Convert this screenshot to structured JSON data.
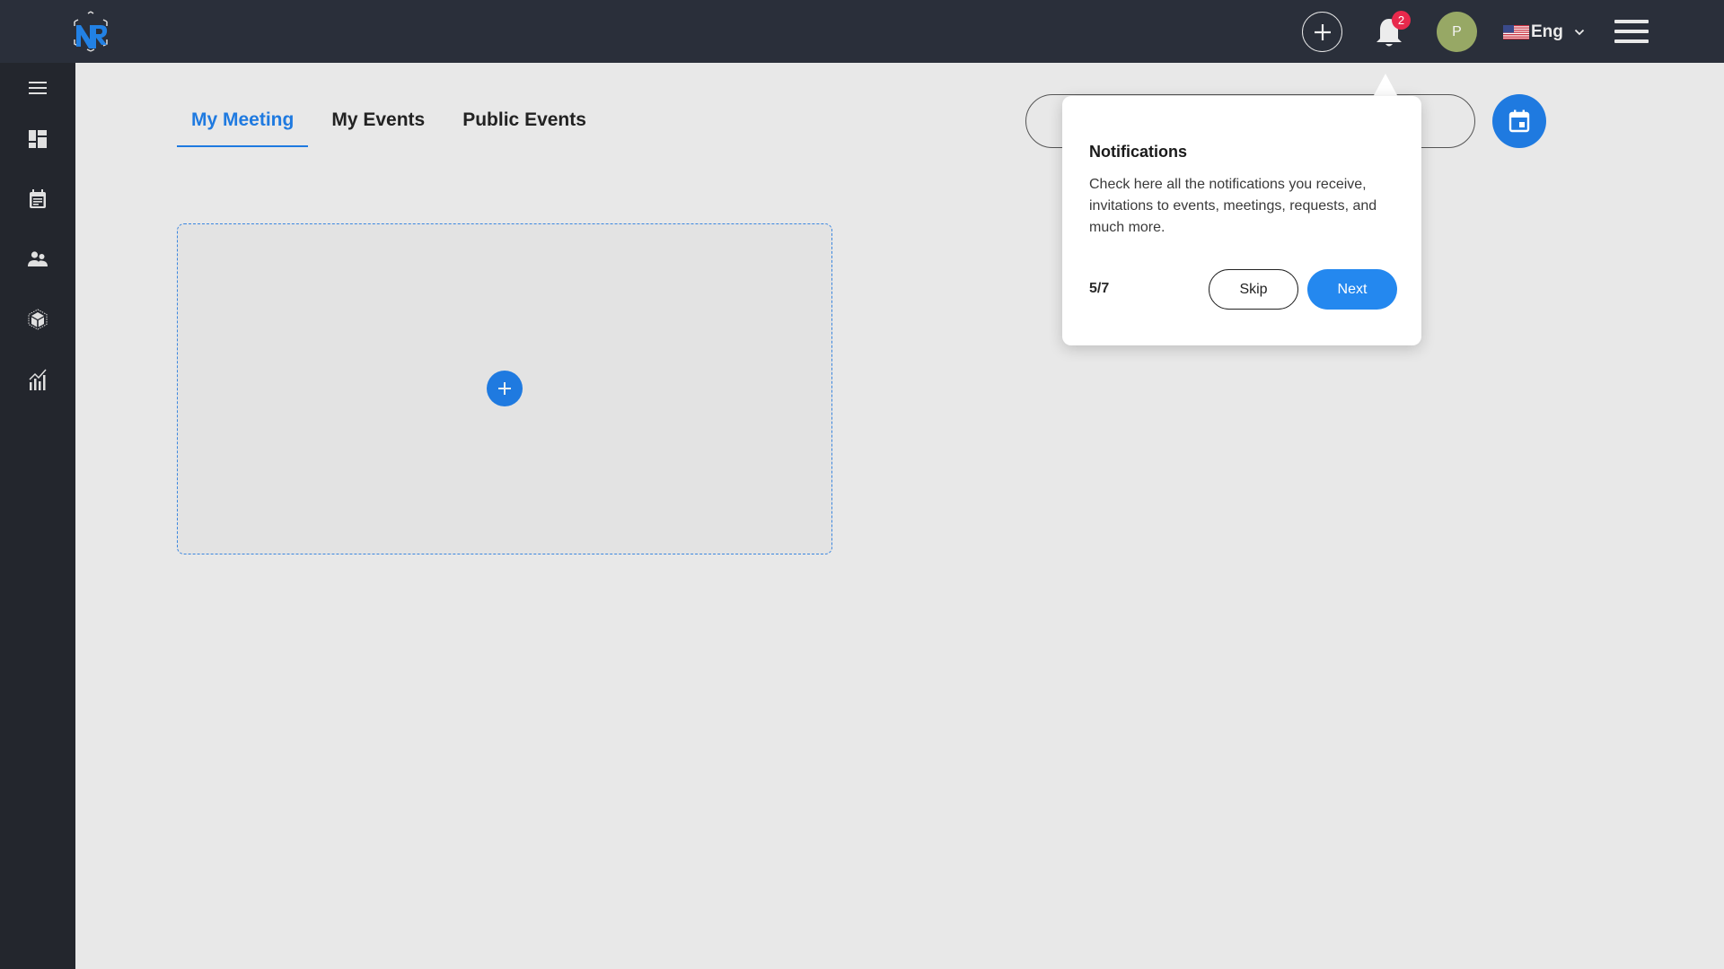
{
  "header": {
    "logo_text": "NR",
    "add_button_label": "Add",
    "notifications": {
      "badge_count": "2"
    },
    "avatar_initial": "P",
    "language": {
      "label": "Eng",
      "flag": "us-flag"
    },
    "menu_icon": "hamburger-icon"
  },
  "sidebar": {
    "items": [
      {
        "name": "menu",
        "icon": "hamburger-icon"
      },
      {
        "name": "dashboard",
        "icon": "dashboard-icon"
      },
      {
        "name": "calendar-events",
        "icon": "calendar-note-icon"
      },
      {
        "name": "contacts",
        "icon": "people-icon"
      },
      {
        "name": "3d-products",
        "icon": "cube-icon"
      },
      {
        "name": "analytics",
        "icon": "chart-icon"
      }
    ]
  },
  "main": {
    "tabs": [
      {
        "label": "My Meeting",
        "active": true
      },
      {
        "label": "My Events",
        "active": false
      },
      {
        "label": "Public Events",
        "active": false
      }
    ],
    "search": {
      "placeholder": ""
    },
    "calendar_button": "calendar-icon"
  },
  "tour_popover": {
    "title": "Notifications",
    "body": "Check here all the notifications you receive, invitations to events, meetings, requests, and much more.",
    "step": "5/7",
    "skip_label": "Skip",
    "next_label": "Next"
  },
  "colors": {
    "accent": "#1f7ae0",
    "topbar": "#2a2f3a",
    "sidebar": "#23262d",
    "badge": "#e8294c",
    "avatar": "#97a865"
  }
}
